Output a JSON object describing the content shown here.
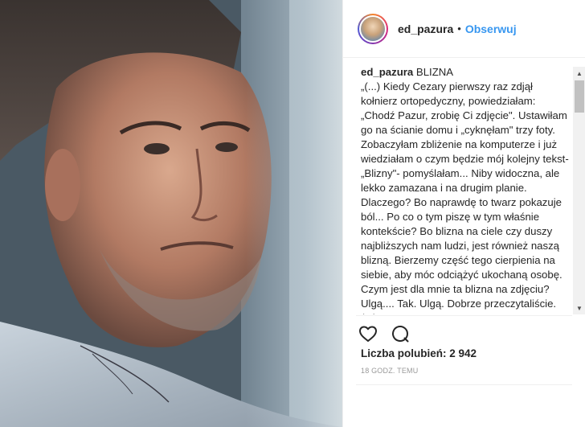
{
  "post": {
    "username": "ed_pazura",
    "separator": "•",
    "follow_label": "Obserwuj"
  },
  "caption": {
    "username": "ed_pazura",
    "text": " BLIZNA\n„(...) Kiedy Cezary pierwszy raz zdjął kołnierz ortopedyczny, powiedziałam: „Chodź Pazur, zrobię Ci zdjęcie\". Ustawiłam go na ścianie domu i „cyknęłam\" trzy foty. Zobaczyłam zbliżenie na komputerze i już wiedziałam o czym będzie mój kolejny tekst-„Blizny\"- pomyślałam... Niby widoczna, ale lekko zamazana i na drugim planie. Dlaczego? Bo naprawdę to twarz pokazuje ból... Po co o tym piszę w tym właśnie kontekście? Bo blizna na ciele czy duszy najbliższych nam ludzi, jest również naszą blizną. Bierzemy część tego cierpienia na siebie, aby móc odciążyć ukochaną osobę. Czym jest dla mnie ta blizna na zdjęciu? Ulgą.... Tak. Ulgą. Dobrze przeczytaliście. (...) „"
  },
  "likes": {
    "text": "Liczba polubień: 2 942"
  },
  "timestamp": {
    "text": "18 GODZ. TEMU"
  },
  "icons": {
    "like": "heart-icon",
    "comment": "comment-icon",
    "scroll_up": "scroll-up-arrow-icon",
    "scroll_down": "scroll-down-arrow-icon"
  },
  "colors": {
    "accent": "#3897f0",
    "text": "#262626",
    "muted": "#999999"
  }
}
